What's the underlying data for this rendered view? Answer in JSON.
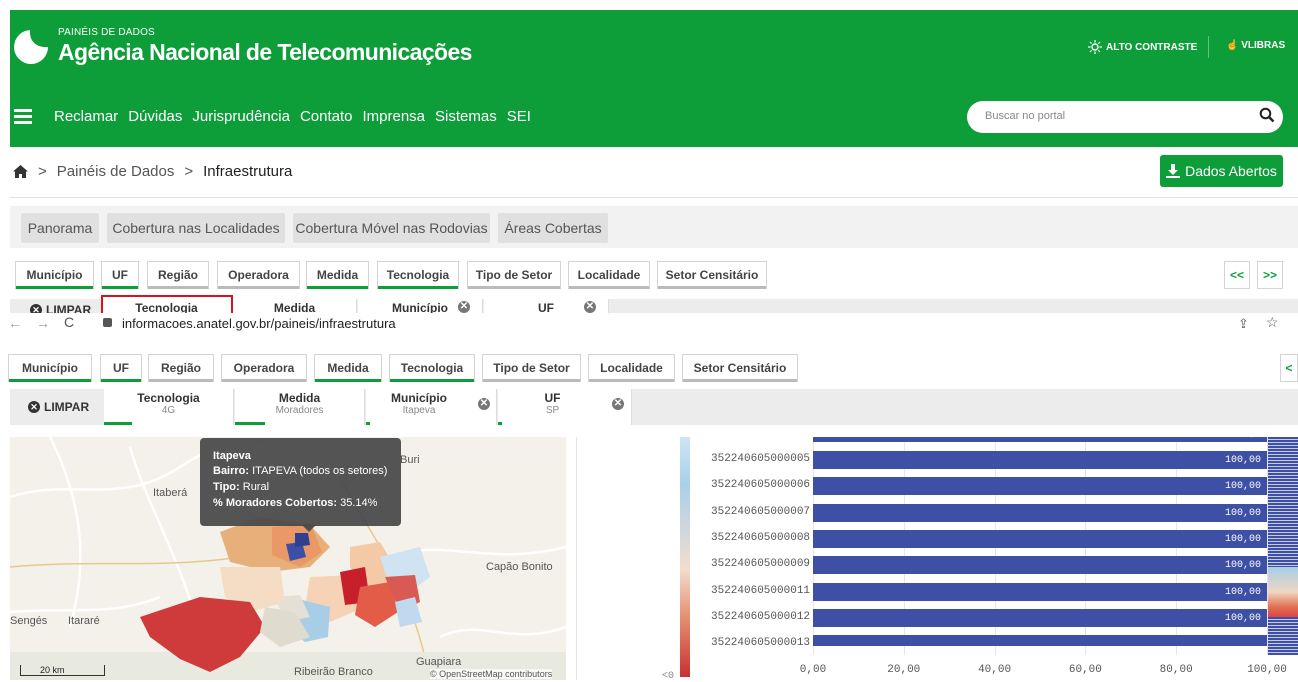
{
  "header": {
    "small_title": "PAINÉIS DE DADOS",
    "title": "Agência Nacional de Telecomunicações",
    "contrast_label": "ALTO CONTRASTE",
    "vlibras_label": "VLIBRAS"
  },
  "menu": {
    "items": [
      "Reclamar",
      "Dúvidas",
      "Jurisprudência",
      "Contato",
      "Imprensa",
      "Sistemas",
      "SEI"
    ],
    "search_placeholder": "Buscar no portal"
  },
  "breadcrumb": {
    "items": [
      "Painéis de Dados",
      "Infraestrutura"
    ],
    "separator": ">"
  },
  "dados_abertos_label": "Dados Abertos",
  "tabs": [
    "Panorama",
    "Cobertura nas Localidades",
    "Cobertura Móvel nas Rodovias",
    "Áreas Cobertas"
  ],
  "filters": [
    "Município",
    "UF",
    "Região",
    "Operadora",
    "Medida",
    "Tecnologia",
    "Tipo de Setor",
    "Localidade",
    "Setor Censitário"
  ],
  "nav": {
    "prev": "<<",
    "next": ">>",
    "prev2": "<"
  },
  "limpar_label": "LIMPAR",
  "selections": [
    {
      "title": "Tecnologia",
      "value": "4G"
    },
    {
      "title": "Medida",
      "value": "Moradores"
    },
    {
      "title": "Município",
      "value": "Itapeva"
    },
    {
      "title": "UF",
      "value": "SP"
    }
  ],
  "browser": {
    "url": "informacoes.anatel.gov.br/paineis/infraestrutura"
  },
  "map": {
    "labels": {
      "buri": "Buri",
      "itabera": "Itaberá",
      "capao": "Capão Bonito",
      "senges": "Sengés",
      "itarare": "Itararé",
      "ribeirao": "Ribeirão Branco",
      "guapiara": "Guapiara"
    },
    "scale": "20 km",
    "attribution": "© OpenStreetMap contributors"
  },
  "tooltip": {
    "title": "Itapeva",
    "bairro_key": "Bairro:",
    "bairro_val": "ITAPEVA (todos os setores)",
    "tipo_key": "Tipo:",
    "tipo_val": "Rural",
    "mor_key": "% Moradores Cobertos:",
    "mor_val": "35.14%"
  },
  "legend_bottom": "<0",
  "colors": {
    "green": "#0d9e3a",
    "bar": "#3e4fa6",
    "red_highlight": "#d7141e"
  },
  "chart_data": {
    "type": "bar",
    "orientation": "horizontal",
    "categories": [
      "352240605000005",
      "352240605000006",
      "352240605000007",
      "352240605000008",
      "352240605000009",
      "352240605000011",
      "352240605000012",
      "352240605000013"
    ],
    "values": [
      100,
      100,
      100,
      100,
      100,
      100,
      100,
      100
    ],
    "value_labels": [
      "100,00",
      "100,00",
      "100,00",
      "100,00",
      "100,00",
      "100,00",
      "100,00",
      "100,00"
    ],
    "top_partial_label": "100,00",
    "xticks": [
      "0,00",
      "20,00",
      "40,00",
      "60,00",
      "80,00",
      "100,00"
    ],
    "xlim": [
      0,
      100
    ]
  }
}
